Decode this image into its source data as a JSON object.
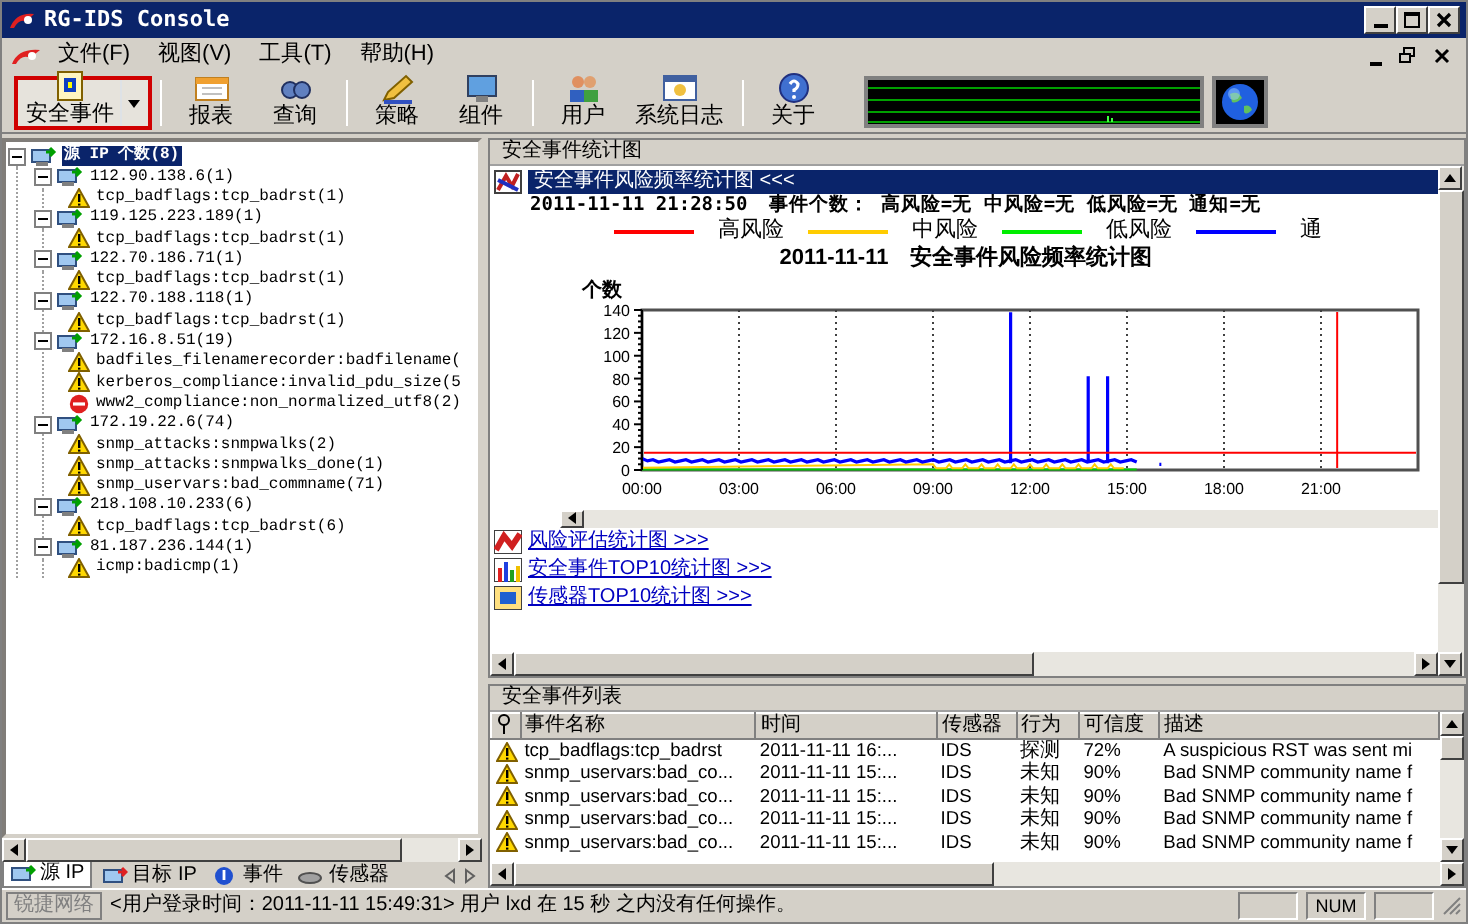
{
  "window": {
    "title": "RG-IDS Console"
  },
  "menu": [
    {
      "label": "文件(F)"
    },
    {
      "label": "视图(V)"
    },
    {
      "label": "工具(T)"
    },
    {
      "label": "帮助(H)"
    }
  ],
  "toolbar": [
    {
      "label": "安全事件",
      "selected": true,
      "dropdown": true
    },
    {
      "label": "报表",
      "selected": false,
      "dropdown": false
    },
    {
      "label": "查询",
      "selected": false,
      "dropdown": false
    },
    {
      "label": "策略",
      "selected": false,
      "dropdown": false
    },
    {
      "label": "组件",
      "selected": false,
      "dropdown": false
    },
    {
      "label": "用户",
      "selected": false,
      "dropdown": false
    },
    {
      "label": "系统日志",
      "selected": false,
      "dropdown": false
    },
    {
      "label": "关于",
      "selected": false,
      "dropdown": false
    }
  ],
  "tree": [
    {
      "label": "源 IP 个数(8)",
      "selected": true,
      "expanded": true,
      "children": [
        {
          "label": "112.90.138.6(1)",
          "expanded": true,
          "children": [
            {
              "label": "tcp_badflags:tcp_badrst(1)",
              "kind": "warning"
            }
          ]
        },
        {
          "label": "119.125.223.189(1)",
          "expanded": true,
          "children": [
            {
              "label": "tcp_badflags:tcp_badrst(1)",
              "kind": "warning"
            }
          ]
        },
        {
          "label": "122.70.186.71(1)",
          "expanded": true,
          "children": [
            {
              "label": "tcp_badflags:tcp_badrst(1)",
              "kind": "warning"
            }
          ]
        },
        {
          "label": "122.70.188.118(1)",
          "expanded": true,
          "children": [
            {
              "label": "tcp_badflags:tcp_badrst(1)",
              "kind": "warning"
            }
          ]
        },
        {
          "label": "172.16.8.51(19)",
          "expanded": true,
          "children": [
            {
              "label": "badfiles_filenamerecorder:badfilename(",
              "kind": "warning"
            },
            {
              "label": "kerberos_compliance:invalid_pdu_size(5",
              "kind": "warning"
            },
            {
              "label": "www2_compliance:non_normalized_utf8(2)",
              "kind": "error"
            }
          ]
        },
        {
          "label": "172.19.22.6(74)",
          "expanded": true,
          "children": [
            {
              "label": "snmp_attacks:snmpwalks(2)",
              "kind": "warning"
            },
            {
              "label": "snmp_attacks:snmpwalks_done(1)",
              "kind": "warning"
            },
            {
              "label": "snmp_uservars:bad_commname(71)",
              "kind": "warning"
            }
          ]
        },
        {
          "label": "218.108.10.233(6)",
          "expanded": true,
          "children": [
            {
              "label": "tcp_badflags:tcp_badrst(6)",
              "kind": "warning"
            }
          ]
        },
        {
          "label": "81.187.236.144(1)",
          "expanded": true,
          "children": [
            {
              "label": "icmp:badicmp(1)",
              "kind": "warning"
            }
          ]
        }
      ]
    }
  ],
  "left_tabs": [
    {
      "label": "源 IP",
      "selected": true
    },
    {
      "label": "目标 IP",
      "selected": false
    },
    {
      "label": "事件",
      "selected": false
    },
    {
      "label": "传感器",
      "selected": false
    }
  ],
  "stats_panel": {
    "header": "安全事件统计图",
    "report_title": "安全事件风险频率统计图 <<<",
    "timestamp": "2011-11-11 21:28:50",
    "summary": "事件个数： 高风险=无  中风险=无  低风险=无  通知=无",
    "legend": [
      {
        "label": "高风险",
        "color": "#ff0000"
      },
      {
        "label": "中风险",
        "color": "#ffcc00"
      },
      {
        "label": "低风险",
        "color": "#00ee00"
      },
      {
        "label": "通",
        "color": "#0000ff"
      }
    ],
    "chart": {
      "title": "2011-11-11　安全事件风险频率统计图",
      "ylabel": "个数",
      "yticks": [
        "140",
        "120",
        "100",
        "80",
        "60",
        "40",
        "20",
        "0"
      ],
      "xticks": [
        "00:00",
        "03:00",
        "06:00",
        "09:00",
        "12:00",
        "15:00",
        "18:00",
        "21:00"
      ]
    },
    "links": [
      "风险评估统计图 >>>",
      "安全事件TOP10统计图 >>>",
      "传感器TOP10统计图 >>>"
    ]
  },
  "event_list": {
    "header": "安全事件列表",
    "columns": [
      "事件名称",
      "时间",
      "传感器",
      "行为",
      "可信度",
      "描述"
    ],
    "rows": [
      [
        "tcp_badflags:tcp_badrst",
        "2011-11-11 16:...",
        "IDS",
        "探测",
        "72%",
        "A suspicious RST was sent mi"
      ],
      [
        "snmp_uservars:bad_co...",
        "2011-11-11 15:...",
        "IDS",
        "未知",
        "90%",
        "Bad SNMP community name f"
      ],
      [
        "snmp_uservars:bad_co...",
        "2011-11-11 15:...",
        "IDS",
        "未知",
        "90%",
        "Bad SNMP community name f"
      ],
      [
        "snmp_uservars:bad_co...",
        "2011-11-11 15:...",
        "IDS",
        "未知",
        "90%",
        "Bad SNMP community name f"
      ],
      [
        "snmp_uservars:bad_co...",
        "2011-11-11 15:...",
        "IDS",
        "未知",
        "90%",
        "Bad SNMP community name f"
      ]
    ]
  },
  "status_bar": {
    "brand": "锐捷网络",
    "message": "<用户登录时间：2011-11-11 15:49:31> 用户 lxd 在 15 秒 之内没有任何操作。",
    "panels": [
      "NUM"
    ]
  }
}
